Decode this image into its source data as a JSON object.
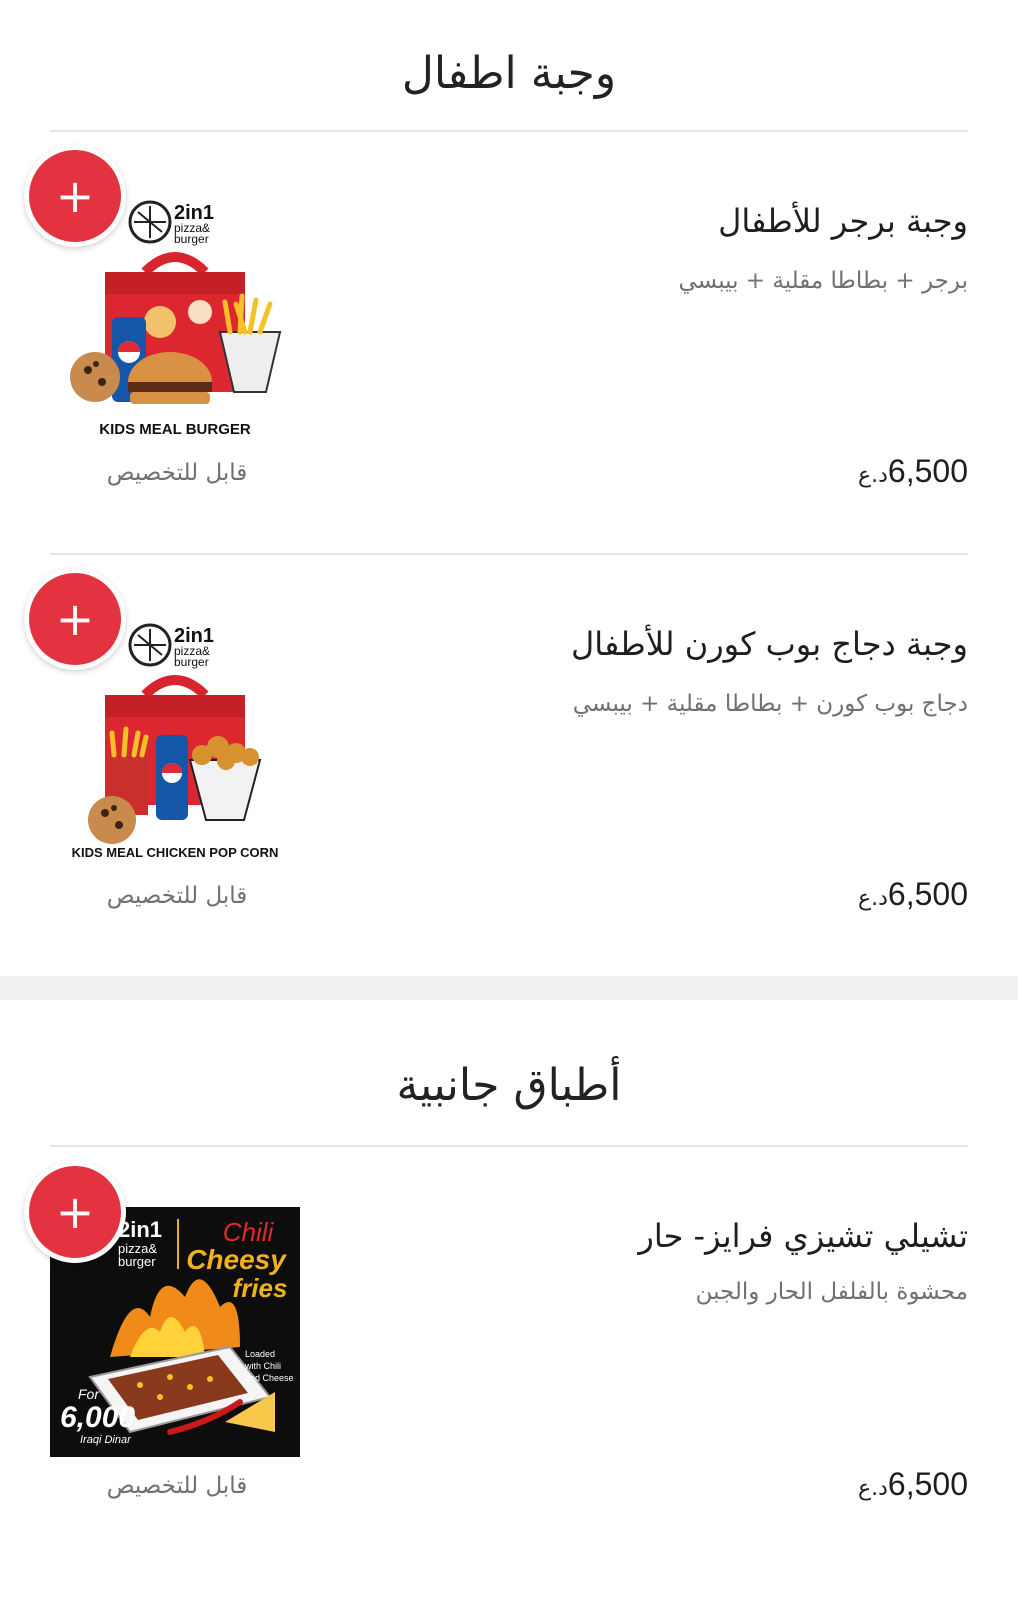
{
  "sections": [
    {
      "title": "وجبة اطفال",
      "items": [
        {
          "name": "وجبة برجر للأطفال",
          "description": "برجر + بطاطا مقلية + بيبسي",
          "price": "6,500",
          "currency": "د.ع",
          "customizable_label": "قابل للتخصيص",
          "image": {
            "brand_top": "2in1",
            "brand_sub1": "pizza&",
            "brand_sub2": "burger",
            "caption": "KIDS MEAL BURGER"
          },
          "add_icon": "plus-icon"
        },
        {
          "name": "وجبة دجاج بوب كورن للأطفال",
          "description": "دجاج بوب كورن + بطاطا مقلية + بيبسي",
          "price": "6,500",
          "currency": "د.ع",
          "customizable_label": "قابل للتخصيص",
          "image": {
            "brand_top": "2in1",
            "brand_sub1": "pizza&",
            "brand_sub2": "burger",
            "caption": "KIDS MEAL CHICKEN POP CORN"
          },
          "add_icon": "plus-icon"
        }
      ]
    },
    {
      "title": "أطباق جانبية",
      "items": [
        {
          "name": "تشيلي تشيزي فرايز- حار",
          "description": "محشوة بالفلفل الحار والجبن",
          "price": "6,500",
          "currency": "د.ع",
          "customizable_label": "قابل للتخصيص",
          "image": {
            "brand_top": "2in1",
            "brand_sub1": "pizza&",
            "brand_sub2": "burger",
            "title1": "Chili",
            "title2": "Cheesy",
            "title3": "fries",
            "note1": "Loaded",
            "note2": "with Chili",
            "note3": "and Cheese",
            "for_label": "For",
            "promo_price": "6,000",
            "promo_unit": "Iraqi Dinar"
          },
          "add_icon": "plus-icon"
        }
      ]
    }
  ],
  "colors": {
    "accent": "#e33340",
    "divider": "#e6e6e6",
    "band": "#eef0f2"
  }
}
